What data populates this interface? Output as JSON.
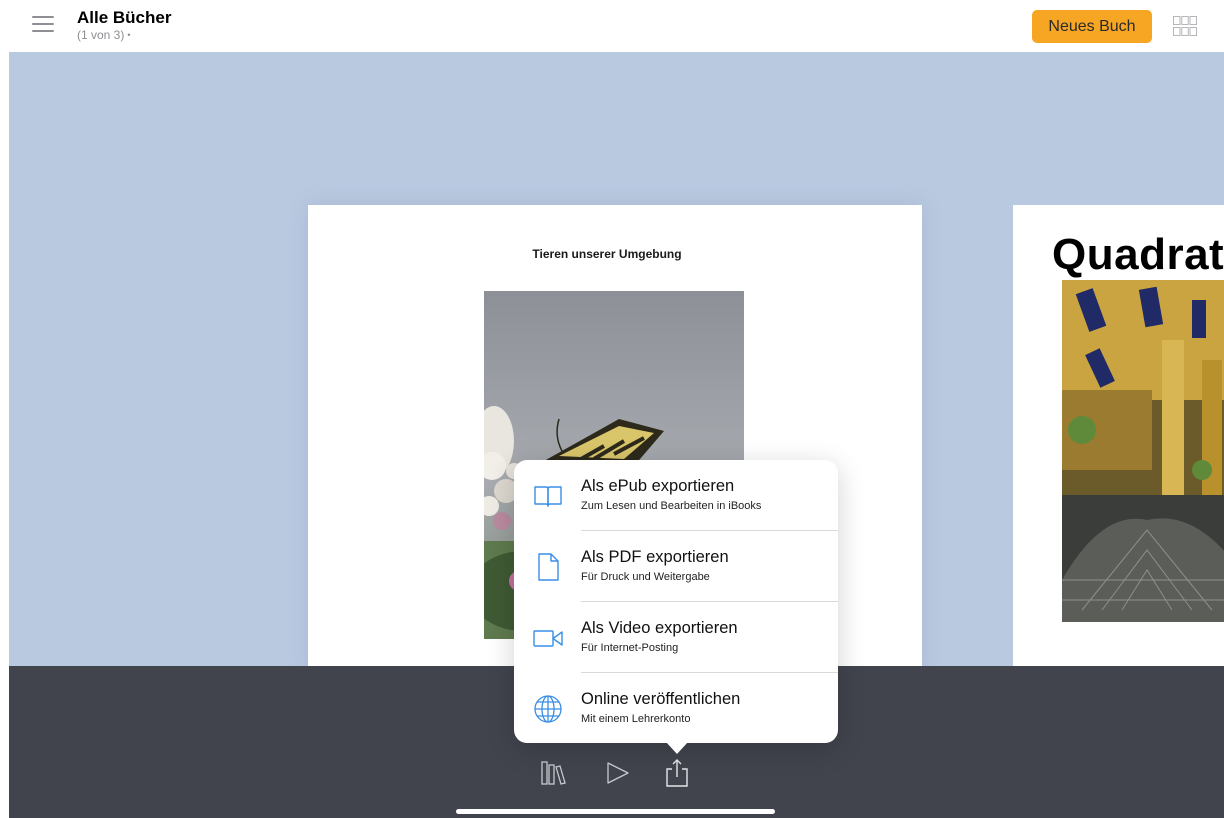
{
  "header": {
    "title": "Alle Bücher",
    "subtitle": "(1 von 3)",
    "new_book_label": "Neues Buch",
    "accent_color": "#f6a623",
    "menu_icon": "hamburger-menu-icon",
    "view_icon": "grid-view-icon"
  },
  "books": [
    {
      "title": "Tieren unserer Umgebung",
      "image": "butterfly-photo"
    },
    {
      "title": "Quadrat",
      "image": "building-photo"
    }
  ],
  "export_menu": {
    "items": [
      {
        "title": "Als ePub exportieren",
        "subtitle": "Zum Lesen und Bearbeiten in iBooks",
        "icon": "book-icon"
      },
      {
        "title": "Als PDF exportieren",
        "subtitle": "Für Druck und Weitergabe",
        "icon": "document-icon"
      },
      {
        "title": "Als Video exportieren",
        "subtitle": "Für Internet-Posting",
        "icon": "video-camera-icon"
      },
      {
        "title": "Online veröffentlichen",
        "subtitle": "Mit einem Lehrerkonto",
        "icon": "globe-icon"
      }
    ],
    "icon_color": "#3a8ee6"
  },
  "toolbar": {
    "icons": [
      "library-icon",
      "play-icon",
      "share-icon"
    ]
  },
  "colors": {
    "canvas_background": "#b9c9e0",
    "bottom_bar": "#41444d"
  }
}
